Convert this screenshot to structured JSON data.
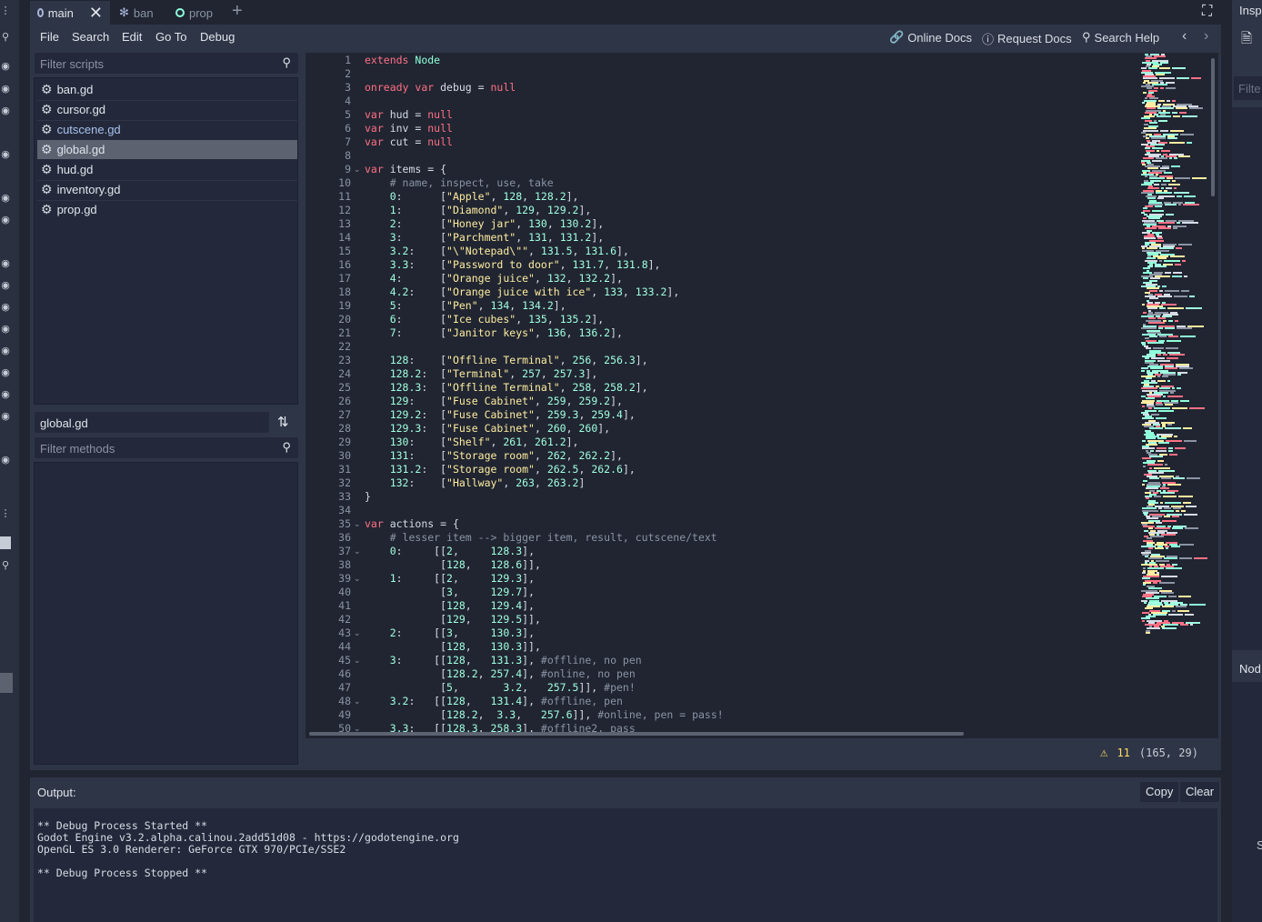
{
  "tabs": [
    {
      "label": "main",
      "icon": "circle-icon"
    },
    {
      "label": "ban",
      "icon": "character-icon"
    },
    {
      "label": "prop",
      "icon": "circle-icon"
    }
  ],
  "menu": [
    "File",
    "Search",
    "Edit",
    "Go To",
    "Debug"
  ],
  "help": [
    {
      "label": "Online Docs",
      "icon": "link-icon"
    },
    {
      "label": "Request Docs",
      "icon": "info-icon"
    },
    {
      "label": "Search Help",
      "icon": "search-help-icon"
    }
  ],
  "scripts_filter_placeholder": "Filter scripts",
  "scripts": [
    {
      "name": "ban.gd",
      "selected": false
    },
    {
      "name": "cursor.gd",
      "selected": false
    },
    {
      "name": "cutscene.gd",
      "selected": false
    },
    {
      "name": "global.gd",
      "selected": true
    },
    {
      "name": "hud.gd",
      "selected": false
    },
    {
      "name": "inventory.gd",
      "selected": false
    },
    {
      "name": "prop.gd",
      "selected": false
    }
  ],
  "current_script": "global.gd",
  "methods_filter_placeholder": "Filter methods",
  "code_lines": [
    "extends Node",
    "",
    "onready var debug = null",
    "",
    "var hud = null",
    "var inv = null",
    "var cut = null",
    "",
    "var items = {",
    "    # name, inspect, use, take",
    "    0:      [\"Apple\", 128, 128.2],",
    "    1:      [\"Diamond\", 129, 129.2],",
    "    2:      [\"Honey jar\", 130, 130.2],",
    "    3:      [\"Parchment\", 131, 131.2],",
    "    3.2:    [\"\\\"Notepad\\\"\", 131.5, 131.6],",
    "    3.3:    [\"Password to door\", 131.7, 131.8],",
    "    4:      [\"Orange juice\", 132, 132.2],",
    "    4.2:    [\"Orange juice with ice\", 133, 133.2],",
    "    5:      [\"Pen\", 134, 134.2],",
    "    6:      [\"Ice cubes\", 135, 135.2],",
    "    7:      [\"Janitor keys\", 136, 136.2],",
    "",
    "    128:    [\"Offline Terminal\", 256, 256.3],",
    "    128.2:  [\"Terminal\", 257, 257.3],",
    "    128.3:  [\"Offline Terminal\", 258, 258.2],",
    "    129:    [\"Fuse Cabinet\", 259, 259.2],",
    "    129.2:  [\"Fuse Cabinet\", 259.3, 259.4],",
    "    129.3:  [\"Fuse Cabinet\", 260, 260],",
    "    130:    [\"Shelf\", 261, 261.2],",
    "    131:    [\"Storage room\", 262, 262.2],",
    "    131.2:  [\"Storage room\", 262.5, 262.6],",
    "    132:    [\"Hallway\", 263, 263.2]",
    "}",
    "",
    "var actions = {",
    "    # lesser item --> bigger item, result, cutscene/text",
    "    0:     [[2,     128.3],",
    "            [128,   128.6]],",
    "    1:     [[2,     129.3],",
    "            [3,     129.7],",
    "            [128,   129.4],",
    "            [129,   129.5]],",
    "    2:     [[3,     130.3],",
    "            [128,   130.3]],",
    "    3:     [[128,   131.3], #offline, no pen",
    "            [128.2, 257.4], #online, no pen",
    "            [5,       3.2,   257.5]], #pen!",
    "    3.2:   [[128,   131.4], #offline, pen",
    "            [128.2,  3.3,   257.6]], #online, pen = pass!",
    "    3.3:   [[128.3, 258.3], #offline2, pass"
  ],
  "fold_lines": [
    9,
    35,
    37,
    39,
    43,
    45,
    48,
    50
  ],
  "status": {
    "warnings": "11",
    "position": "(165, 29)"
  },
  "output": {
    "label": "Output:",
    "copy": "Copy",
    "clear": "Clear",
    "text": "** Debug Process Started **\nGodot Engine v3.2.alpha.calinou.2add51d08 - https://godotengine.org\nOpenGL ES 3.0 Renderer: GeForce GTX 970/PCIe/SSE2\n\n** Debug Process Stopped **"
  },
  "right_panel": {
    "title": "Insp",
    "filter": "Filte",
    "node": "Nod",
    "letter": "S"
  }
}
